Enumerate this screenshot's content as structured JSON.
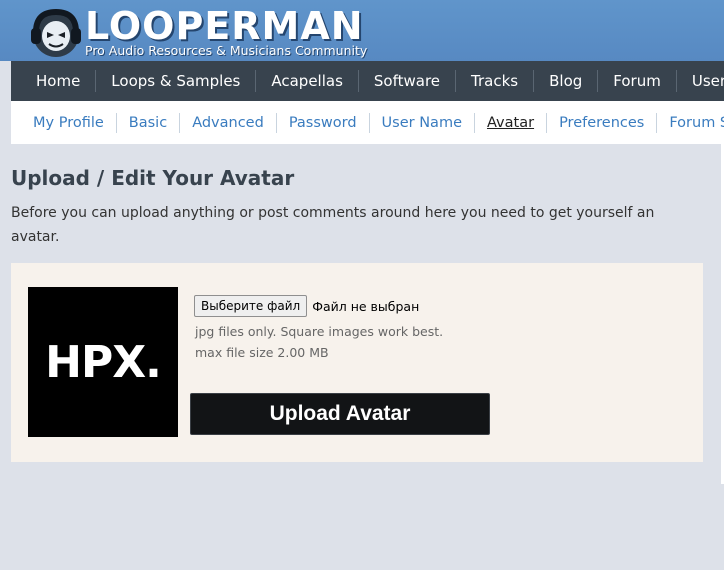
{
  "header": {
    "logo_text": "LOOPERMAN",
    "tagline": "Pro Audio Resources & Musicians Community",
    "mascot_icon": "headphone-skull-mascot"
  },
  "main_nav": {
    "items": [
      "Home",
      "Loops & Samples",
      "Acapellas",
      "Software",
      "Tracks",
      "Blog",
      "Forum",
      "Users"
    ]
  },
  "sub_nav": {
    "items": [
      "My Profile",
      "Basic",
      "Advanced",
      "Password",
      "User Name",
      "Avatar",
      "Preferences",
      "Forum Sig"
    ],
    "active": "Avatar"
  },
  "page": {
    "title": "Upload / Edit Your Avatar",
    "intro": "Before you can upload anything or post comments around here you need to get yourself an avatar."
  },
  "avatar_panel": {
    "avatar_text": "HPX.",
    "file_button": "Выберите файл",
    "file_status": "Файл не выбран",
    "hint_format": "jpg files only. Square images work best.",
    "hint_size": "max file size 2.00 MB",
    "upload_button": "Upload Avatar"
  },
  "colors": {
    "header_bg": "#5a8dc6",
    "nav_bg": "#38434e",
    "link": "#3a7cbf",
    "panel_bg": "#f7f2ec",
    "page_bg": "#dde1e9"
  }
}
